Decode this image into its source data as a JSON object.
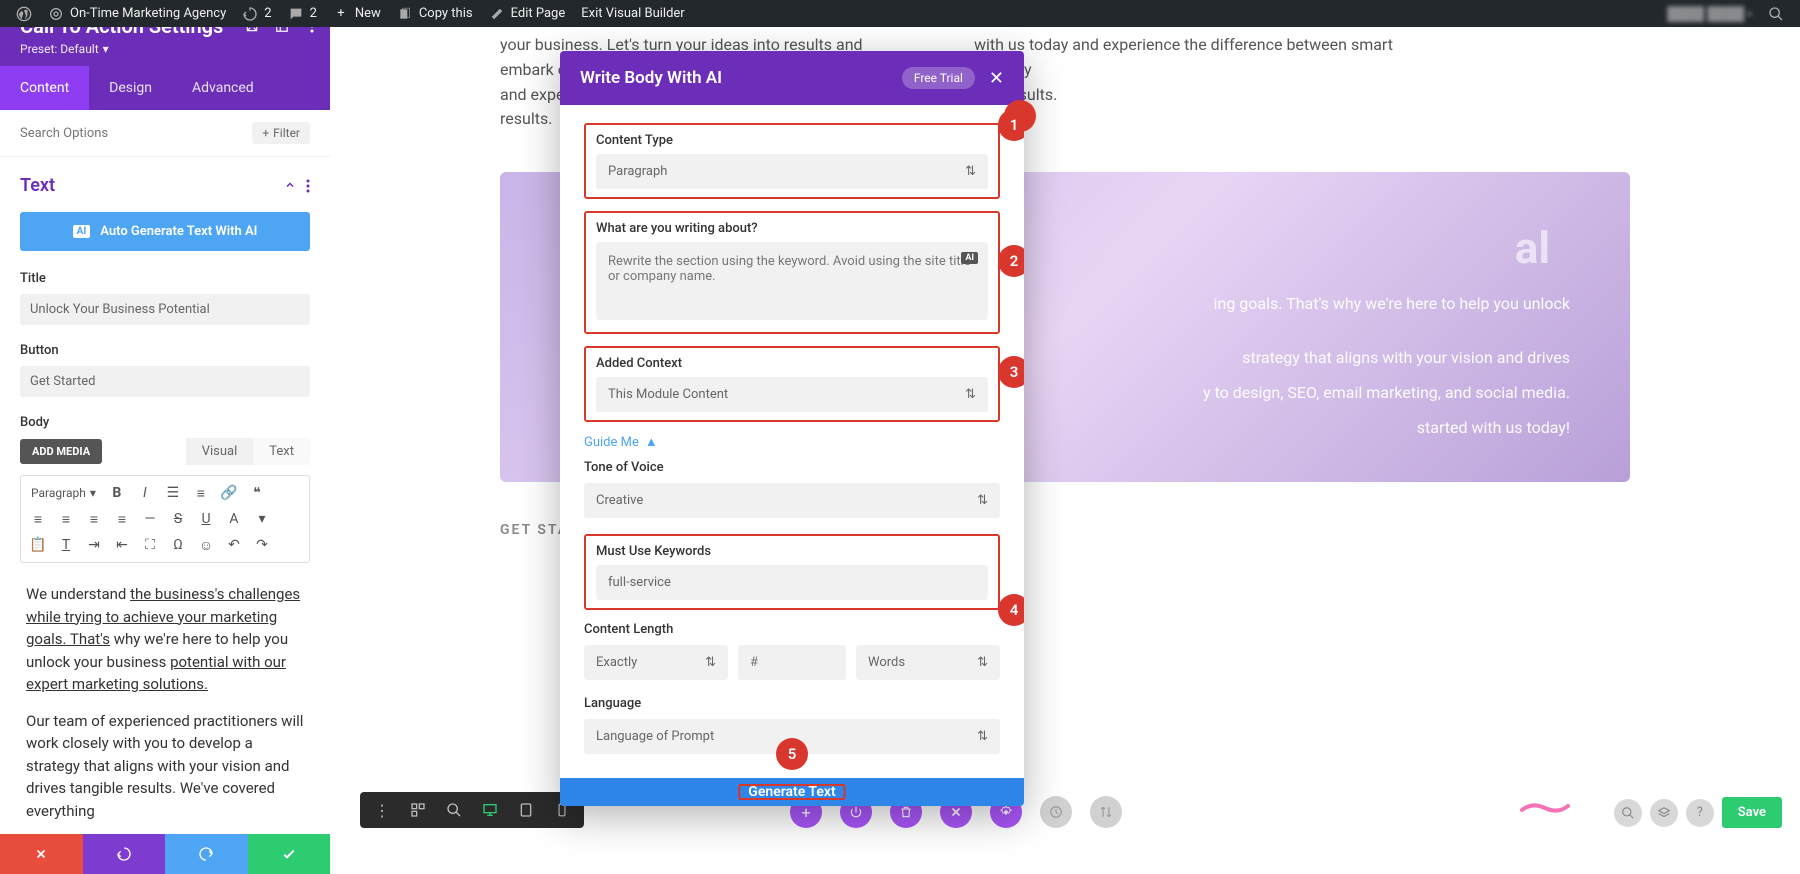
{
  "adminBar": {
    "site": "On-Time Marketing Agency",
    "revisions": "2",
    "comments": "2",
    "new": "New",
    "copy": "Copy this",
    "edit": "Edit Page",
    "exit": "Exit Visual Builder"
  },
  "sidebar": {
    "title": "Call To Action Settings",
    "preset": "Preset: Default",
    "tabs": {
      "content": "Content",
      "design": "Design",
      "advanced": "Advanced"
    },
    "searchPlaceholder": "Search Options",
    "filter": "Filter",
    "section": "Text",
    "aiBtn": "Auto Generate Text With AI",
    "aiBadge": "AI",
    "titleLabel": "Title",
    "titleValue": "Unlock Your Business Potential",
    "buttonLabel": "Button",
    "buttonValue": "Get Started",
    "bodyLabel": "Body",
    "addMedia": "ADD MEDIA",
    "visual": "Visual",
    "textTab": "Text",
    "paraSelect": "Paragraph",
    "bodyP1a": "We understand ",
    "bodyP1b": "the business's challenges while trying to achieve your marketing goals. That's",
    "bodyP1c": " why we're here to help you unlock your business ",
    "bodyP1d": "potential with our expert marketing solutions.",
    "bodyP2": "Our team of experienced practitioners will work closely with you to develop a strategy that aligns with your vision and drives tangible results. We've covered everything"
  },
  "canvas": {
    "p1": "your business. Let's turn your ideas into results and embark on a journey t",
    "p1b": "and expe",
    "p1c": "results.",
    "p2": "with us today and experience the difference between smart strategy",
    "p2b": "ong results.",
    "heroTitle": "al",
    "heroP1": "ing goals. That's why we're here to help you unlock",
    "heroP2": "strategy that aligns with your vision and drives",
    "heroP3": "y to design, SEO, email marketing, and social media.",
    "heroP4": "started with us today!",
    "getStarted": "GET STARTED"
  },
  "modal": {
    "title": "Write Body With AI",
    "freeTrial": "Free Trial",
    "contentTypeLabel": "Content Type",
    "contentTypeValue": "Paragraph",
    "writingLabel": "What are you writing about?",
    "writingValue": "Rewrite the section using the keyword. Avoid using the site title or company name.",
    "contextLabel": "Added Context",
    "contextValue": "This Module Content",
    "guide": "Guide Me",
    "toneLabel": "Tone of Voice",
    "toneValue": "Creative",
    "keywordsLabel": "Must Use Keywords",
    "keywordsValue": "full-service",
    "lengthLabel": "Content Length",
    "lengthValue": "Exactly",
    "numPlaceholder": "#",
    "unitValue": "Words",
    "langLabel": "Language",
    "langValue": "Language of Prompt",
    "generate": "Generate Text",
    "badges": {
      "b1": "1",
      "b2": "2",
      "b3": "3",
      "b4": "4",
      "b5": "5"
    }
  },
  "save": "Save"
}
